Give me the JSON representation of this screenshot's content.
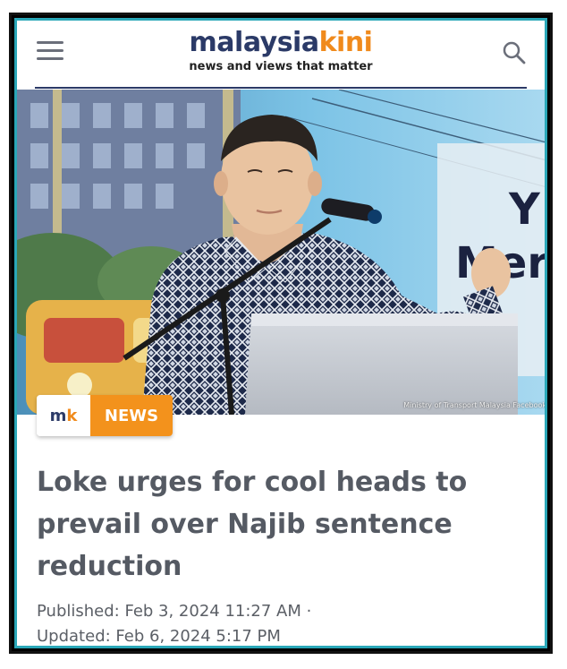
{
  "header": {
    "logo_part1": "malaysia",
    "logo_part2": "kini",
    "tagline": "news and views that matter",
    "brand_colors": {
      "navy": "#2b3a67",
      "orange": "#f08a1c",
      "frame_teal": "#2aa7b8"
    }
  },
  "photo": {
    "credit": "Ministry of Transport Malaysia Facebook",
    "backdrop_text": [
      "Y",
      "Mer"
    ]
  },
  "badge": {
    "logo_m": "m",
    "logo_k": "k",
    "label": "NEWS"
  },
  "article": {
    "headline": "Loke urges for cool heads to prevail over Najib sentence reduction",
    "published": "Published:  Feb 3, 2024 11:27 AM ·",
    "updated": "Updated: Feb 6, 2024 5:17 PM"
  },
  "icons": [
    "hamburger-menu-icon",
    "search-icon"
  ]
}
